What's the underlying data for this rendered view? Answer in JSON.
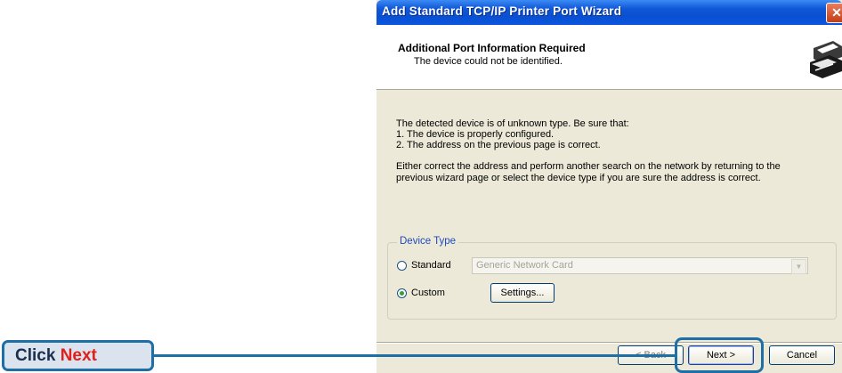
{
  "window": {
    "title": "Add Standard TCP/IP Printer Port Wizard",
    "close_glyph": "✕"
  },
  "header": {
    "title": "Additional Port Information Required",
    "subtitle": "The device could not be identified."
  },
  "body": {
    "lines": [
      "The detected device is of unknown type.  Be sure that:",
      "1. The device is properly configured.",
      "2.  The address on the previous page is correct.",
      "Either correct the address and perform another search on the network by returning to the",
      "previous wizard page or select the device type if you are sure the address is correct."
    ]
  },
  "device_type": {
    "legend": "Device Type",
    "standard_label": "Standard",
    "standard_value": "Generic Network Card",
    "custom_label": "Custom",
    "settings_label": "Settings...",
    "selected": "Custom"
  },
  "footer": {
    "back_label": "< Back",
    "next_label": "Next >",
    "cancel_label": "Cancel"
  },
  "callout": {
    "prefix": "Click",
    "emphasis": "Next"
  },
  "colors": {
    "callout_border": "#1e6fa6",
    "callout_emphasis": "#e0201a",
    "titlebar": "#0a4fd0"
  }
}
